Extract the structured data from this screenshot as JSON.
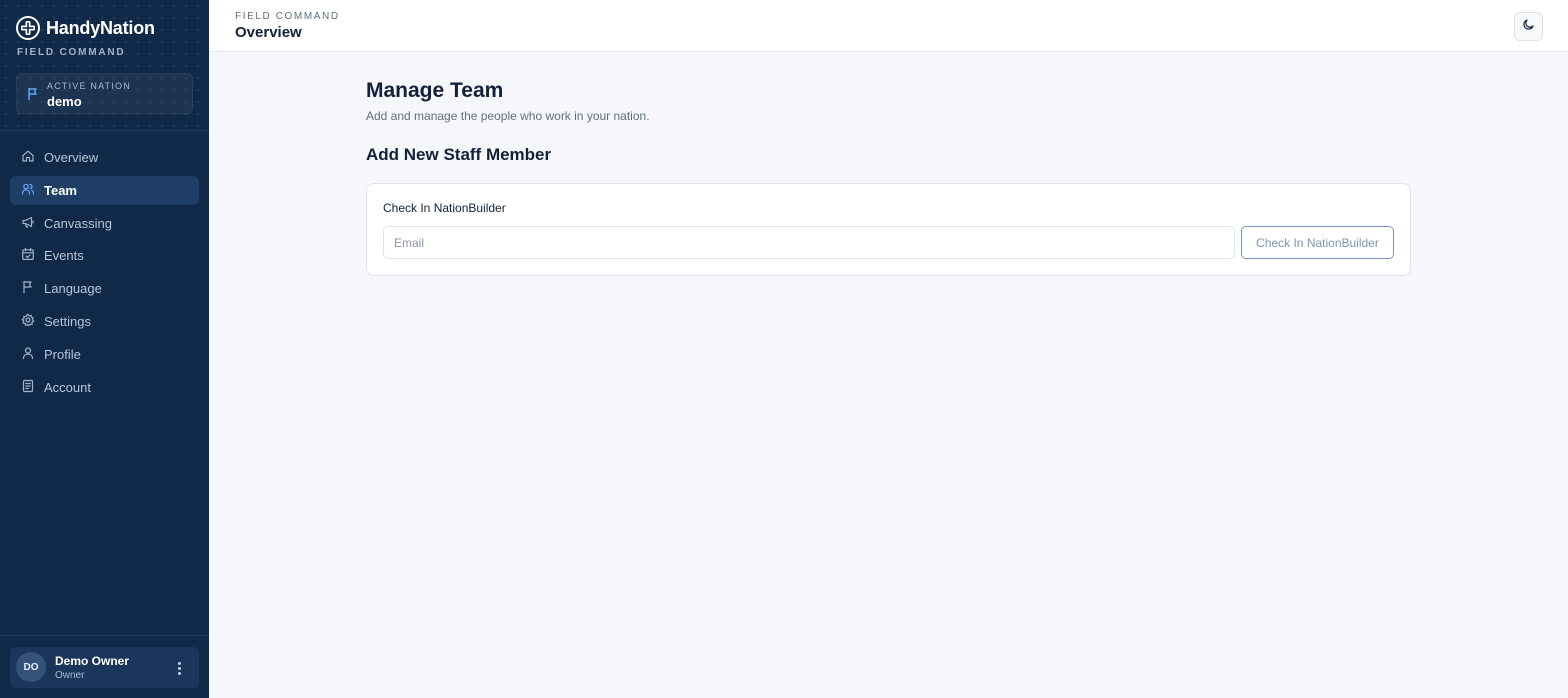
{
  "sidebar": {
    "brand": {
      "name": "HandyNation",
      "subtitle": "FIELD COMMAND",
      "logo_icon": "handynation-logo-icon"
    },
    "active_nation": {
      "label": "ACTIVE NATION",
      "value": "demo",
      "icon": "flag-icon"
    },
    "nav": [
      {
        "label": "Overview",
        "icon": "home-icon",
        "active": false
      },
      {
        "label": "Team",
        "icon": "users-icon",
        "active": true
      },
      {
        "label": "Canvassing",
        "icon": "megaphone-icon",
        "active": false
      },
      {
        "label": "Events",
        "icon": "calendar-check-icon",
        "active": false
      },
      {
        "label": "Language",
        "icon": "flag-icon",
        "active": false
      },
      {
        "label": "Settings",
        "icon": "gear-icon",
        "active": false
      },
      {
        "label": "Profile",
        "icon": "user-icon",
        "active": false
      },
      {
        "label": "Account",
        "icon": "receipt-icon",
        "active": false
      }
    ],
    "user": {
      "initials": "DO",
      "name": "Demo Owner",
      "role": "Owner",
      "menu_icon": "more-vertical-icon"
    }
  },
  "header": {
    "eyebrow": "FIELD COMMAND",
    "title": "Overview",
    "theme_icon": "moon-icon"
  },
  "main": {
    "title": "Manage Team",
    "subtitle": "Add and manage the people who work in your nation.",
    "section_title": "Add New Staff Member",
    "card": {
      "label": "Check In NationBuilder",
      "email_placeholder": "Email",
      "email_value": "",
      "button_label": "Check In NationBuilder"
    }
  },
  "colors": {
    "sidebar_bg": "#112949",
    "nav_active_bg": "#1e3e66",
    "page_bg": "#f5f7fa",
    "text_primary": "#14213a",
    "button_outline": "#7d95b8",
    "accent_blue": "#5b9cf0"
  }
}
